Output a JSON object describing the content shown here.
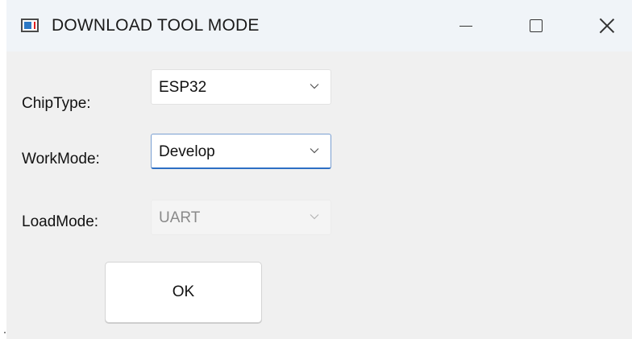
{
  "window": {
    "title": "DOWNLOAD TOOL MODE"
  },
  "form": {
    "chip_type": {
      "label": "ChipType:",
      "value": "ESP32",
      "state": "enabled"
    },
    "work_mode": {
      "label": "WorkMode:",
      "value": "Develop",
      "state": "focused"
    },
    "load_mode": {
      "label": "LoadMode:",
      "value": "UART",
      "state": "disabled"
    }
  },
  "buttons": {
    "ok_label": "OK"
  },
  "icons": {
    "app": "app-window-icon",
    "minimize": "minimize-icon",
    "maximize": "maximize-icon",
    "close": "close-icon",
    "dropdown": "chevron-down-icon"
  },
  "colors": {
    "title_bar": "#f0f4f8",
    "window_bg": "#f0f0f0",
    "focus_accent": "#2d6fc4",
    "disabled_text": "#8a8a8a",
    "app_icon_blue": "#2b78c5",
    "app_icon_red": "#e02020"
  }
}
